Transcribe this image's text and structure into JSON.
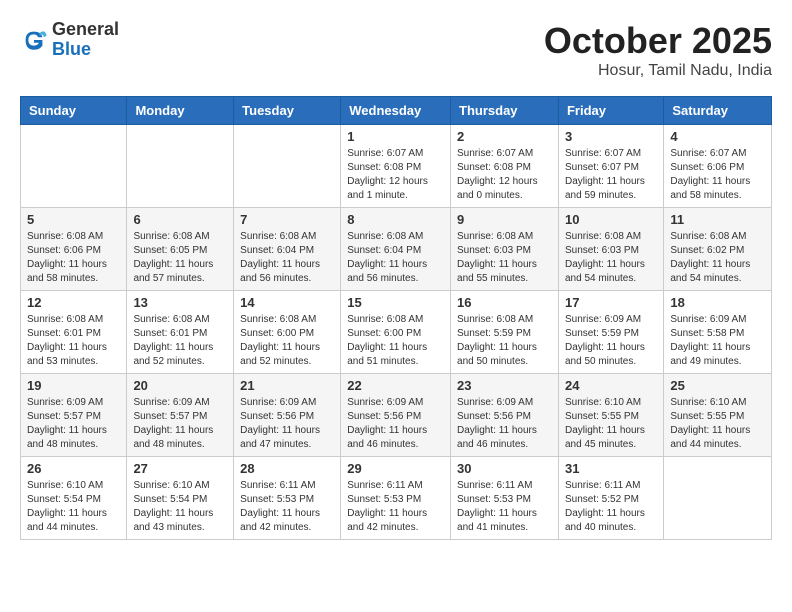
{
  "header": {
    "logo_general": "General",
    "logo_blue": "Blue",
    "month": "October 2025",
    "location": "Hosur, Tamil Nadu, India"
  },
  "weekdays": [
    "Sunday",
    "Monday",
    "Tuesday",
    "Wednesday",
    "Thursday",
    "Friday",
    "Saturday"
  ],
  "weeks": [
    [
      null,
      null,
      null,
      {
        "day": "1",
        "sunrise": "6:07 AM",
        "sunset": "6:08 PM",
        "daylight": "12 hours and 1 minute."
      },
      {
        "day": "2",
        "sunrise": "6:07 AM",
        "sunset": "6:08 PM",
        "daylight": "12 hours and 0 minutes."
      },
      {
        "day": "3",
        "sunrise": "6:07 AM",
        "sunset": "6:07 PM",
        "daylight": "11 hours and 59 minutes."
      },
      {
        "day": "4",
        "sunrise": "6:07 AM",
        "sunset": "6:06 PM",
        "daylight": "11 hours and 58 minutes."
      }
    ],
    [
      {
        "day": "5",
        "sunrise": "6:08 AM",
        "sunset": "6:06 PM",
        "daylight": "11 hours and 58 minutes."
      },
      {
        "day": "6",
        "sunrise": "6:08 AM",
        "sunset": "6:05 PM",
        "daylight": "11 hours and 57 minutes."
      },
      {
        "day": "7",
        "sunrise": "6:08 AM",
        "sunset": "6:04 PM",
        "daylight": "11 hours and 56 minutes."
      },
      {
        "day": "8",
        "sunrise": "6:08 AM",
        "sunset": "6:04 PM",
        "daylight": "11 hours and 56 minutes."
      },
      {
        "day": "9",
        "sunrise": "6:08 AM",
        "sunset": "6:03 PM",
        "daylight": "11 hours and 55 minutes."
      },
      {
        "day": "10",
        "sunrise": "6:08 AM",
        "sunset": "6:03 PM",
        "daylight": "11 hours and 54 minutes."
      },
      {
        "day": "11",
        "sunrise": "6:08 AM",
        "sunset": "6:02 PM",
        "daylight": "11 hours and 54 minutes."
      }
    ],
    [
      {
        "day": "12",
        "sunrise": "6:08 AM",
        "sunset": "6:01 PM",
        "daylight": "11 hours and 53 minutes."
      },
      {
        "day": "13",
        "sunrise": "6:08 AM",
        "sunset": "6:01 PM",
        "daylight": "11 hours and 52 minutes."
      },
      {
        "day": "14",
        "sunrise": "6:08 AM",
        "sunset": "6:00 PM",
        "daylight": "11 hours and 52 minutes."
      },
      {
        "day": "15",
        "sunrise": "6:08 AM",
        "sunset": "6:00 PM",
        "daylight": "11 hours and 51 minutes."
      },
      {
        "day": "16",
        "sunrise": "6:08 AM",
        "sunset": "5:59 PM",
        "daylight": "11 hours and 50 minutes."
      },
      {
        "day": "17",
        "sunrise": "6:09 AM",
        "sunset": "5:59 PM",
        "daylight": "11 hours and 50 minutes."
      },
      {
        "day": "18",
        "sunrise": "6:09 AM",
        "sunset": "5:58 PM",
        "daylight": "11 hours and 49 minutes."
      }
    ],
    [
      {
        "day": "19",
        "sunrise": "6:09 AM",
        "sunset": "5:57 PM",
        "daylight": "11 hours and 48 minutes."
      },
      {
        "day": "20",
        "sunrise": "6:09 AM",
        "sunset": "5:57 PM",
        "daylight": "11 hours and 48 minutes."
      },
      {
        "day": "21",
        "sunrise": "6:09 AM",
        "sunset": "5:56 PM",
        "daylight": "11 hours and 47 minutes."
      },
      {
        "day": "22",
        "sunrise": "6:09 AM",
        "sunset": "5:56 PM",
        "daylight": "11 hours and 46 minutes."
      },
      {
        "day": "23",
        "sunrise": "6:09 AM",
        "sunset": "5:56 PM",
        "daylight": "11 hours and 46 minutes."
      },
      {
        "day": "24",
        "sunrise": "6:10 AM",
        "sunset": "5:55 PM",
        "daylight": "11 hours and 45 minutes."
      },
      {
        "day": "25",
        "sunrise": "6:10 AM",
        "sunset": "5:55 PM",
        "daylight": "11 hours and 44 minutes."
      }
    ],
    [
      {
        "day": "26",
        "sunrise": "6:10 AM",
        "sunset": "5:54 PM",
        "daylight": "11 hours and 44 minutes."
      },
      {
        "day": "27",
        "sunrise": "6:10 AM",
        "sunset": "5:54 PM",
        "daylight": "11 hours and 43 minutes."
      },
      {
        "day": "28",
        "sunrise": "6:11 AM",
        "sunset": "5:53 PM",
        "daylight": "11 hours and 42 minutes."
      },
      {
        "day": "29",
        "sunrise": "6:11 AM",
        "sunset": "5:53 PM",
        "daylight": "11 hours and 42 minutes."
      },
      {
        "day": "30",
        "sunrise": "6:11 AM",
        "sunset": "5:53 PM",
        "daylight": "11 hours and 41 minutes."
      },
      {
        "day": "31",
        "sunrise": "6:11 AM",
        "sunset": "5:52 PM",
        "daylight": "11 hours and 40 minutes."
      },
      null
    ]
  ]
}
